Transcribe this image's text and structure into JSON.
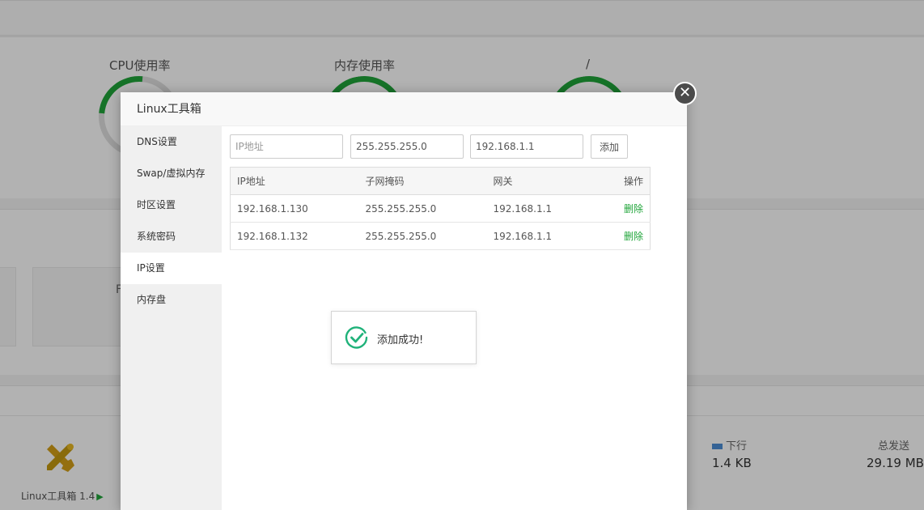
{
  "background": {
    "gauges": [
      {
        "title": "CPU使用率"
      },
      {
        "title": "内存使用率"
      },
      {
        "title": "/"
      }
    ],
    "partial_letter": "F",
    "network": {
      "down_label": "下行",
      "down_value": "1.4 KB",
      "total_sent_label": "总发送",
      "total_sent_value": "29.19 MB",
      "down_color": "#4d8fd6"
    },
    "software": {
      "tool_label": "Linux工具箱 1.4",
      "tool_icon": "tools-icon",
      "play_icon": "▶"
    }
  },
  "modal": {
    "title": "Linux工具箱",
    "close_icon": "close-icon",
    "sidebar": {
      "items": [
        {
          "label": "DNS设置",
          "active": false
        },
        {
          "label": "Swap/虚拟内存",
          "active": false
        },
        {
          "label": "时区设置",
          "active": false
        },
        {
          "label": "系统密码",
          "active": false
        },
        {
          "label": "IP设置",
          "active": true
        },
        {
          "label": "内存盘",
          "active": false
        }
      ]
    },
    "form": {
      "ip_placeholder": "IP地址",
      "ip_value": "",
      "mask_value": "255.255.255.0",
      "gateway_value": "192.168.1.1",
      "add_label": "添加"
    },
    "table": {
      "headers": [
        "IP地址",
        "子网掩码",
        "网关",
        "操作"
      ],
      "rows": [
        {
          "ip": "192.168.1.130",
          "mask": "255.255.255.0",
          "gateway": "192.168.1.1",
          "action": "删除"
        },
        {
          "ip": "192.168.1.132",
          "mask": "255.255.255.0",
          "gateway": "192.168.1.1",
          "action": "删除"
        }
      ]
    }
  },
  "toast": {
    "message": "添加成功!",
    "icon": "check-circle-icon",
    "color": "#20b27a"
  },
  "colors": {
    "accent_green": "#20a53a"
  }
}
